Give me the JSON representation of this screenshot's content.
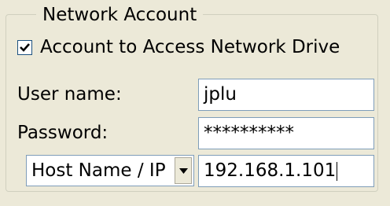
{
  "group": {
    "title": "Network Account"
  },
  "checkbox": {
    "label": "Account to Access Network Drive",
    "checked": true
  },
  "fields": {
    "username_label": "User name:",
    "username_value": "jplu",
    "password_label": "Password:",
    "password_value": "**********",
    "host_type": "Host Name / IP",
    "host_value": "192.168.1.101"
  },
  "icons": {
    "checkmark": "check-icon",
    "dropdown": "chevron-down-icon"
  },
  "colors": {
    "background": "#ece9d8",
    "input_border": "#7f9db9",
    "group_border": "#d0d0bf"
  }
}
